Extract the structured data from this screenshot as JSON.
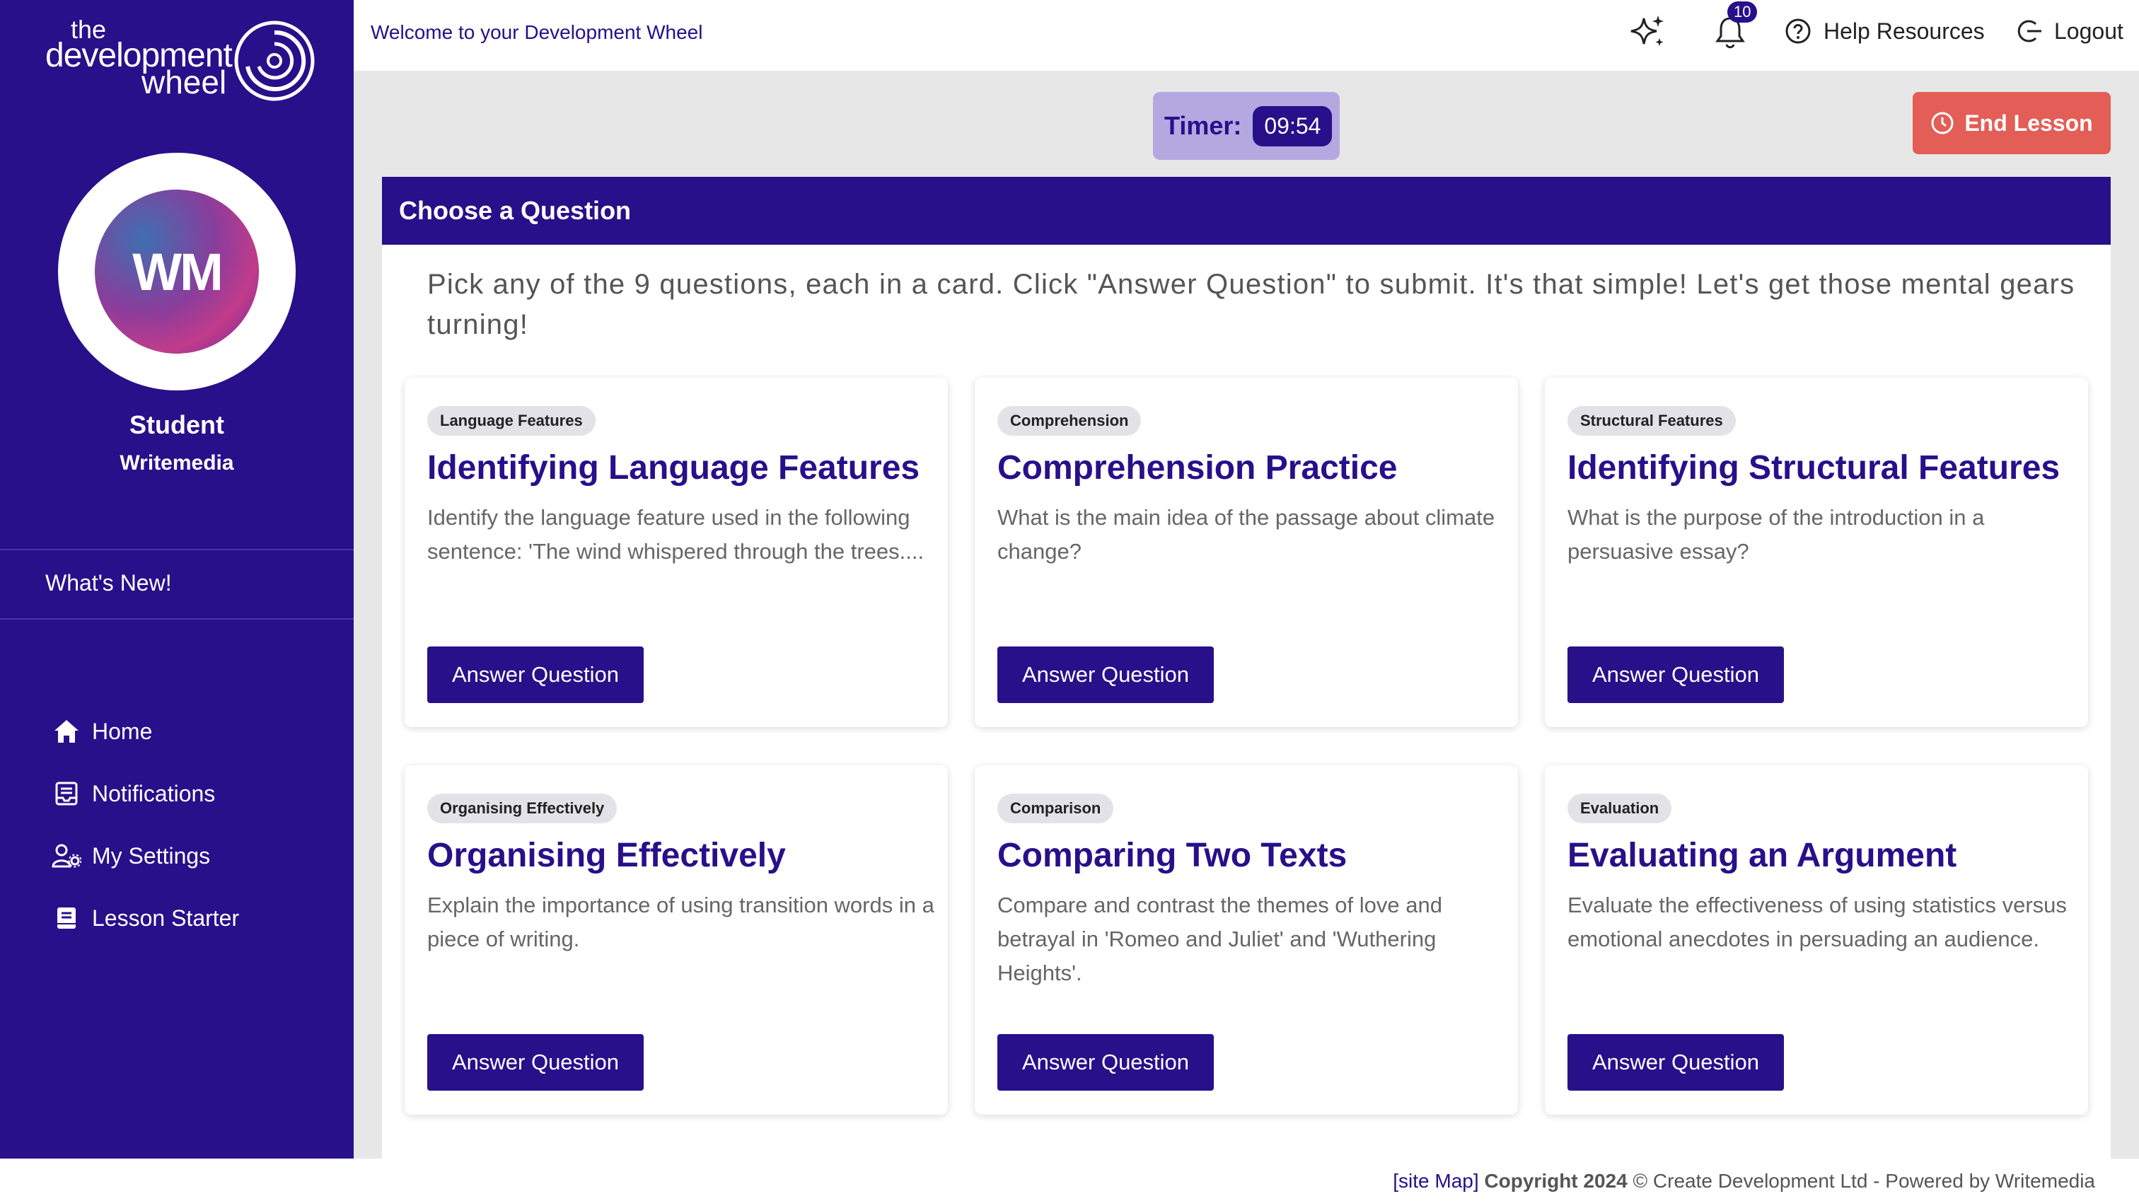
{
  "logo": {
    "line1": "the",
    "line2": "development",
    "line3": "wheel"
  },
  "user": {
    "initials": "WM",
    "name": "Student",
    "org": "Writemedia"
  },
  "sidebar": {
    "whats_new": "What's New!",
    "items": [
      {
        "label": "Home",
        "icon": "home-icon"
      },
      {
        "label": "Notifications",
        "icon": "inbox-icon"
      },
      {
        "label": "My Settings",
        "icon": "user-settings-icon"
      },
      {
        "label": "Lesson Starter",
        "icon": "book-icon"
      }
    ]
  },
  "topbar": {
    "welcome": "Welcome to your Development Wheel",
    "notification_count": "10",
    "help_label": "Help Resources",
    "logout_label": "Logout"
  },
  "timer": {
    "label": "Timer:",
    "value": "09:54"
  },
  "end_lesson_label": "End Lesson",
  "panel": {
    "title": "Choose a Question",
    "intro": "Pick any of the 9 questions, each in a card. Click \"Answer Question\" to submit. It's that simple! Let's get those mental gears turning!"
  },
  "cards": [
    {
      "tag": "Language Features",
      "title": "Identifying Language Features",
      "desc": "Identify the language feature used in the following sentence: 'The wind whispered through the trees....",
      "button": "Answer Question"
    },
    {
      "tag": "Comprehension",
      "title": "Comprehension Practice",
      "desc": "What is the main idea of the passage about climate change?",
      "button": "Answer Question"
    },
    {
      "tag": "Structural Features",
      "title": "Identifying Structural Features",
      "desc": "What is the purpose of the introduction in a persuasive essay?",
      "button": "Answer Question"
    },
    {
      "tag": "Organising Effectively",
      "title": "Organising Effectively",
      "desc": "Explain the importance of using transition words in a piece of writing.",
      "button": "Answer Question"
    },
    {
      "tag": "Comparison",
      "title": "Comparing Two Texts",
      "desc": "Compare and contrast the themes of love and betrayal in 'Romeo and Juliet' and 'Wuthering Heights'.",
      "button": "Answer Question"
    },
    {
      "tag": "Evaluation",
      "title": "Evaluating an Argument",
      "desc": "Evaluate the effectiveness of using statistics versus emotional anecdotes in persuading an audience.",
      "button": "Answer Question"
    }
  ],
  "footer": {
    "site_map": "[site Map]",
    "copyright": "Copyright 2024",
    "rest": "© Create Development Ltd - Powered by Writemedia"
  },
  "colors": {
    "brand": "#27108a",
    "end_lesson": "#e35e56",
    "timer_bg": "#b3a8e0"
  }
}
